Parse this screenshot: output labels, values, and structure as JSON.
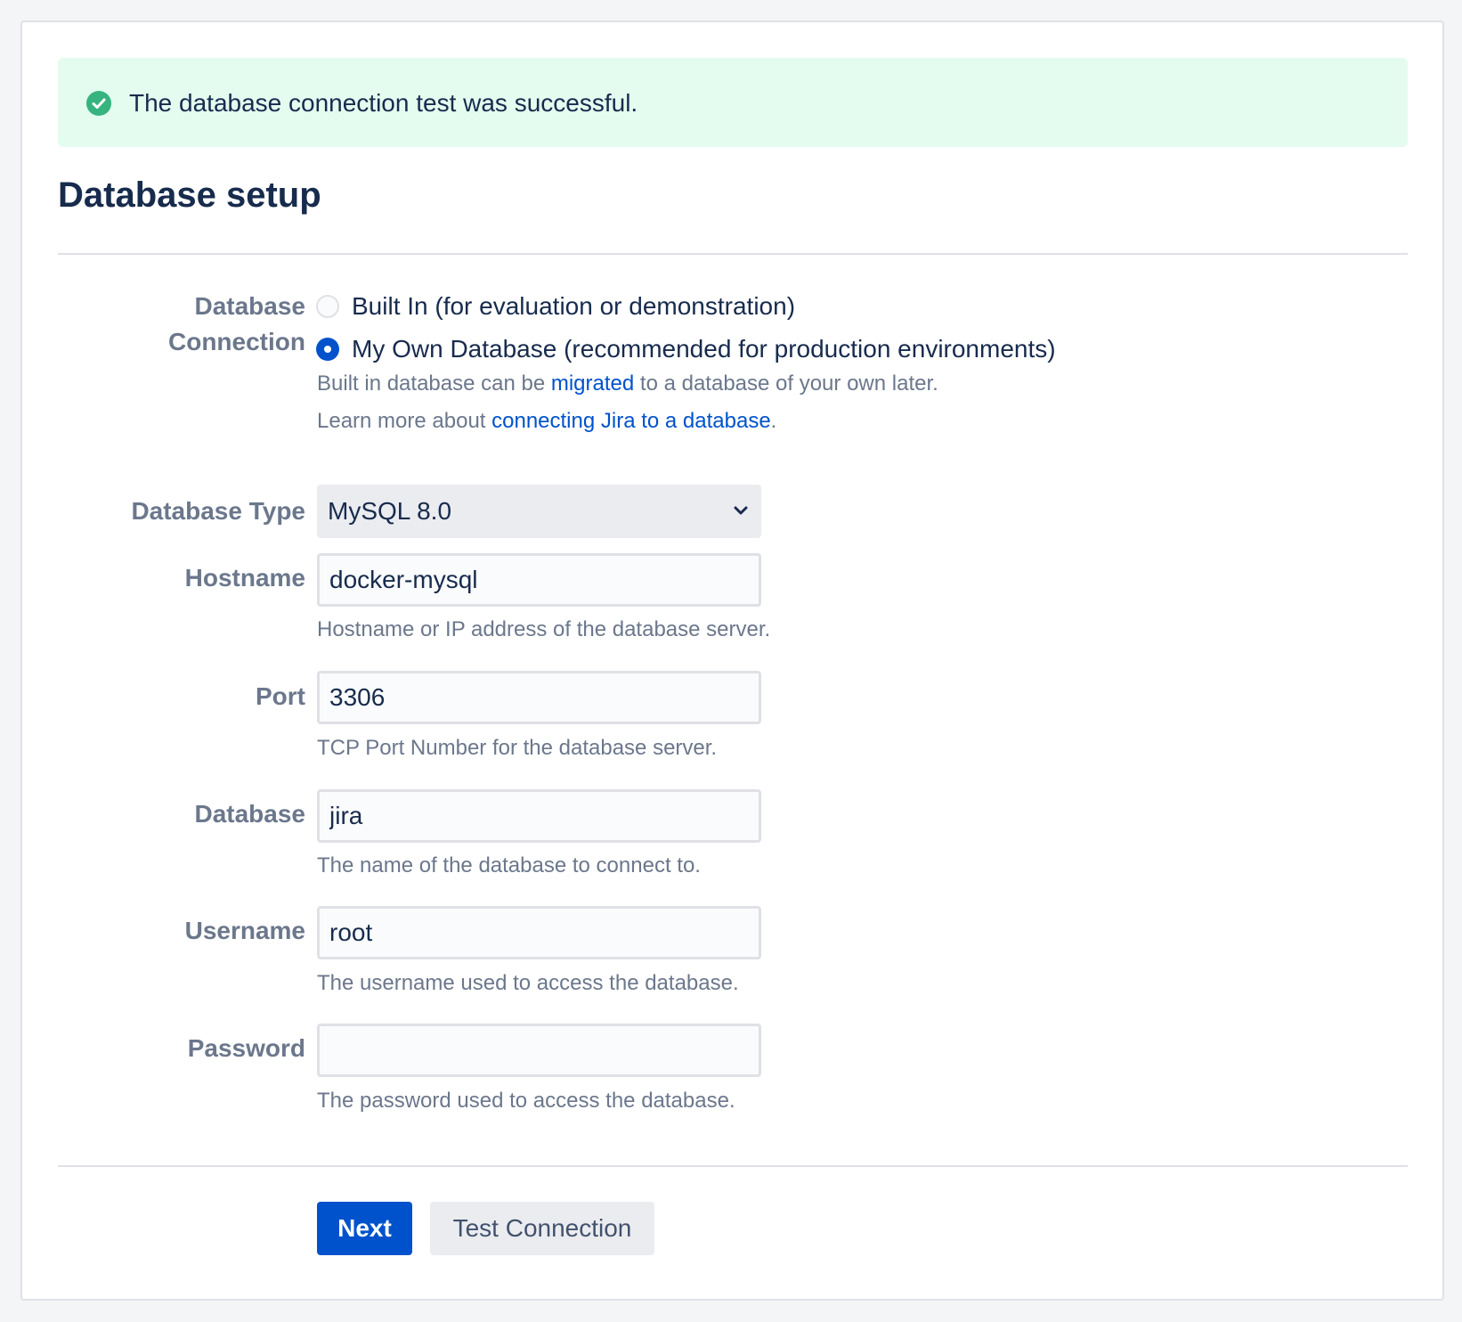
{
  "banner": {
    "icon": "check-circle-icon",
    "message": "The database connection test was successful.",
    "color": "#e3fcef",
    "icon_color": "#36b37e"
  },
  "page_title": "Database setup",
  "connection": {
    "label_line1": "Database",
    "label_line2": "Connection",
    "options": [
      {
        "label": "Built In (for evaluation or demonstration)",
        "checked": false
      },
      {
        "label": "My Own Database (recommended for production environments)",
        "checked": true
      }
    ],
    "help1_prefix": "Built in database can be ",
    "help1_link": "migrated",
    "help1_suffix": " to a database of your own later.",
    "help2_prefix": "Learn more about ",
    "help2_link": "connecting Jira to a database",
    "help2_suffix": "."
  },
  "database_type": {
    "label": "Database Type",
    "selected": "MySQL 8.0",
    "icon": "chevron-down-icon"
  },
  "hostname": {
    "label": "Hostname",
    "value": "docker-mysql",
    "help": "Hostname or IP address of the database server."
  },
  "port": {
    "label": "Port",
    "value": "3306",
    "help": "TCP Port Number for the database server."
  },
  "database": {
    "label": "Database",
    "value": "jira",
    "help": "The name of the database to connect to."
  },
  "username": {
    "label": "Username",
    "value": "root",
    "help": "The username used to access the database."
  },
  "password": {
    "label": "Password",
    "value": "",
    "help": "The password used to access the database."
  },
  "buttons": {
    "next": "Next",
    "test_connection": "Test Connection"
  },
  "colors": {
    "primary": "#0052cc",
    "link": "#0052cc",
    "label": "#6b778c",
    "text": "#172b4d"
  }
}
